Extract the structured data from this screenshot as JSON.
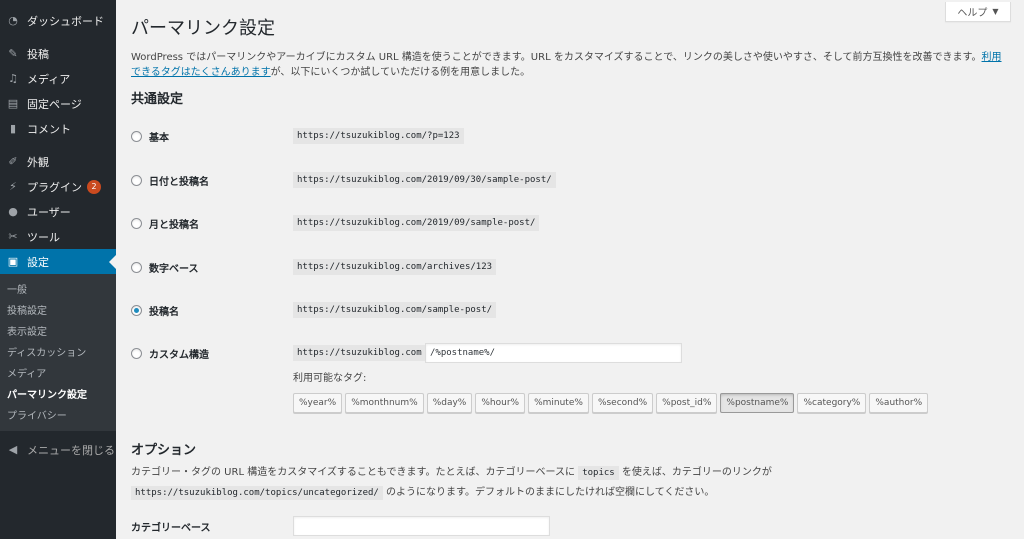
{
  "sidebar": {
    "items": [
      {
        "label": "ダッシュボード",
        "icon": "dashboard-icon"
      },
      {
        "label": "投稿",
        "icon": "pin-icon"
      },
      {
        "label": "メディア",
        "icon": "media-icon"
      },
      {
        "label": "固定ページ",
        "icon": "page-icon"
      },
      {
        "label": "コメント",
        "icon": "comment-icon"
      },
      {
        "label": "外観",
        "icon": "brush-icon"
      },
      {
        "label": "プラグイン",
        "icon": "plugin-icon",
        "badge": "2"
      },
      {
        "label": "ユーザー",
        "icon": "user-icon"
      },
      {
        "label": "ツール",
        "icon": "wrench-icon"
      },
      {
        "label": "設定",
        "icon": "settings-icon"
      }
    ],
    "submenu": [
      "一般",
      "投稿設定",
      "表示設定",
      "ディスカッション",
      "メディア",
      "パーマリンク設定",
      "プライバシー"
    ],
    "collapse_label": "メニューを閉じる"
  },
  "help_label": "ヘルプ",
  "page_title": "パーマリンク設定",
  "intro": {
    "text": "WordPress ではパーマリンクやアーカイブにカスタム URL 構造を使うことができます。URL をカスタマイズすることで、リンクの美しさや使いやすさ、そして前方互換性を改善できます。",
    "link": "利用できるタグはたくさんあります",
    "suffix": "が、以下にいくつか試していただける例を用意しました。"
  },
  "common_heading": "共通設定",
  "options": [
    {
      "label": "基本",
      "example": "https://tsuzukiblog.com/?p=123",
      "checked": false
    },
    {
      "label": "日付と投稿名",
      "example": "https://tsuzukiblog.com/2019/09/30/sample-post/",
      "checked": false
    },
    {
      "label": "月と投稿名",
      "example": "https://tsuzukiblog.com/2019/09/sample-post/",
      "checked": false
    },
    {
      "label": "数字ベース",
      "example": "https://tsuzukiblog.com/archives/123",
      "checked": false
    },
    {
      "label": "投稿名",
      "example": "https://tsuzukiblog.com/sample-post/",
      "checked": true
    }
  ],
  "custom": {
    "label": "カスタム構造",
    "prefix": "https://tsuzukiblog.com",
    "value": "/%postname%/",
    "tags_label": "利用可能なタグ:",
    "tags": [
      "%year%",
      "%monthnum%",
      "%day%",
      "%hour%",
      "%minute%",
      "%second%",
      "%post_id%",
      "%postname%",
      "%category%",
      "%author%"
    ],
    "active_tag": "%postname%"
  },
  "options_heading": "オプション",
  "options_desc": {
    "part1": "カテゴリー・タグの URL 構造をカスタマイズすることもできます。たとえば、カテゴリーベースに",
    "code1": "topics",
    "part2": "を使えば、カテゴリーのリンクが",
    "code2": "https://tsuzukiblog.com/topics/uncategorized/",
    "part3": "のようになります。デフォルトのままにしたければ空欄にしてください。"
  },
  "category_base_label": "カテゴリーベース",
  "colors": {
    "accent": "#0073aa",
    "sidebar": "#23282d",
    "badge": "#ca4a1f"
  }
}
